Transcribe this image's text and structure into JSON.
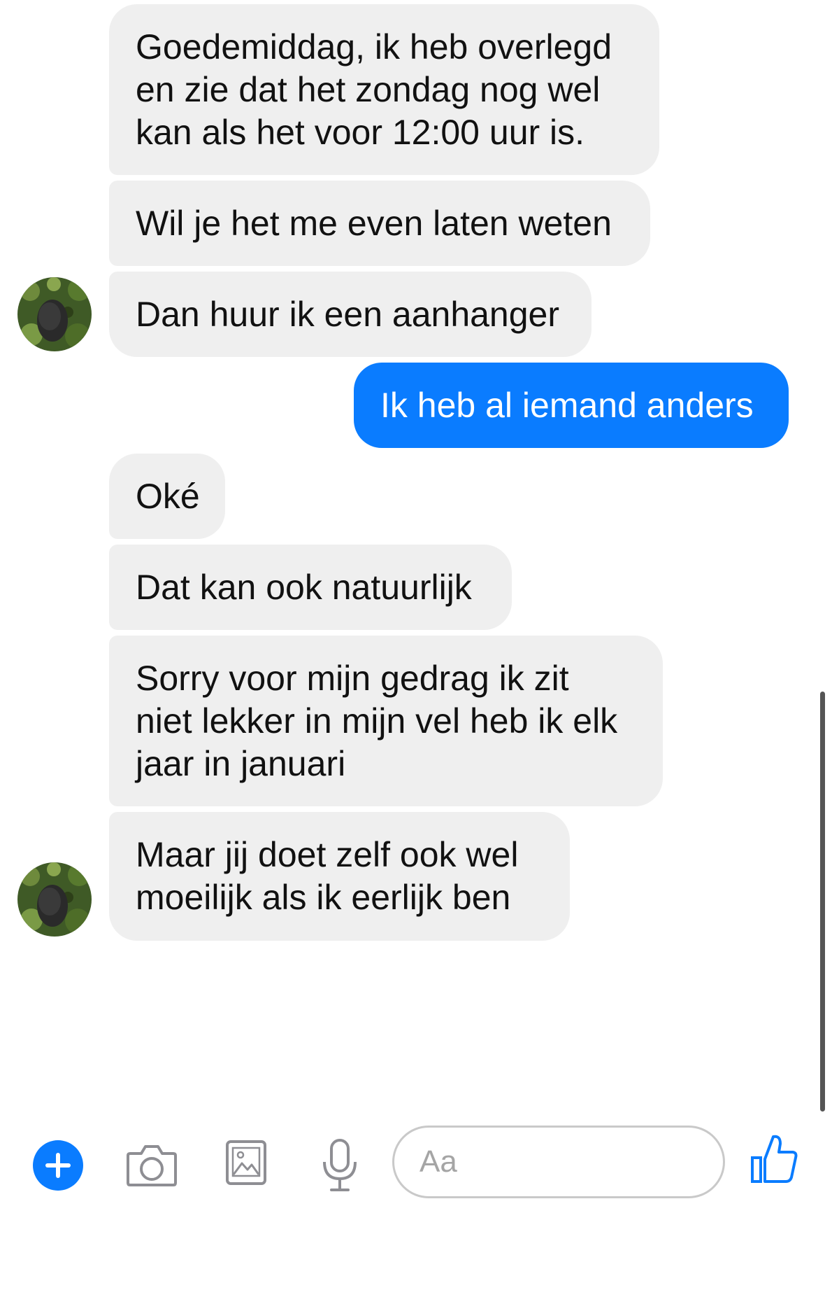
{
  "conversation": {
    "messages": [
      {
        "text": "Goedemiddag, ik heb overlegd\nen zie dat het zondag nog wel\nkan als het voor 12:00 uur is.",
        "sender": "other"
      },
      {
        "text": "Wil je het me even laten weten",
        "sender": "other"
      },
      {
        "text": "Dan huur ik een aanhanger",
        "sender": "other"
      },
      {
        "text": "Ik heb al iemand anders",
        "sender": "me"
      },
      {
        "text": "Oké",
        "sender": "other"
      },
      {
        "text": "Dat kan ook natuurlijk",
        "sender": "other"
      },
      {
        "text": "Sorry voor mijn gedrag ik zit\nniet lekker in mijn vel heb ik elk\njaar in januari",
        "sender": "other"
      },
      {
        "text": "Maar jij doet zelf ook wel\nmoeilijk als ik eerlijk ben",
        "sender": "other"
      }
    ]
  },
  "composer": {
    "placeholder": "Aa",
    "icons": [
      "plus-icon",
      "camera-icon",
      "image-icon",
      "microphone-icon",
      "thumbs-up-icon"
    ]
  },
  "colors": {
    "incoming_bubble": "#efefef",
    "outgoing_bubble": "#0a7cff",
    "accent": "#0a7cff"
  }
}
